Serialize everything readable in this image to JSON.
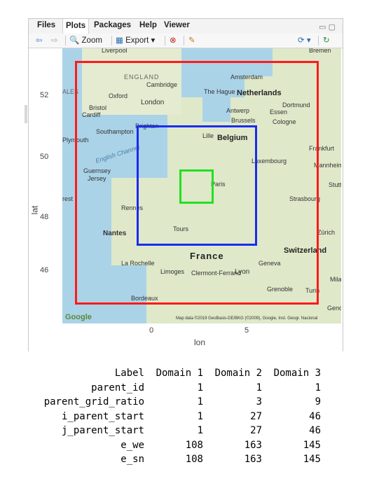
{
  "tabs": [
    "Files",
    "Plots",
    "Packages",
    "Help",
    "Viewer"
  ],
  "active_tab": "Plots",
  "toolbar": {
    "zoom_label": "Zoom",
    "export_label": "Export ▾",
    "back_icon": "arrow-left-icon",
    "forward_icon": "arrow-right-icon",
    "zoom_icon": "magnifier-icon",
    "export_icon": "image-icon",
    "remove_icon": "remove-plot-icon",
    "clear_icon": "broom-icon",
    "publish_icon": "publish-icon",
    "refresh_icon": "refresh-icon"
  },
  "plot": {
    "x_title": "lon",
    "y_title": "lat",
    "x_ticks": [
      "0",
      "5"
    ],
    "y_ticks": [
      "46",
      "48",
      "50",
      "52"
    ],
    "attribution": "Map data ©2019 GeoBasis-DE/BKG (©2009), Google, Inst. Geogr. Nacional",
    "google_logo": "Google"
  },
  "map_labels": {
    "liverpool": "Liverpool",
    "bremen": "Bremen",
    "england": "ENGLAND",
    "cambridge": "Cambridge",
    "amsterdam": "Amsterdam",
    "wales": "ALES",
    "oxford": "Oxford",
    "london": "London",
    "hague": "The Hague",
    "netherlands": "Netherlands",
    "bristol": "Bristol",
    "cardiff": "Cardiff",
    "antwerp": "Antwerp",
    "dortmund": "Dortmund",
    "essen": "Essen",
    "brussels": "Brussels",
    "cologne": "Cologne",
    "brighton": "Brighton",
    "southampton": "Southampton",
    "lille": "Lille",
    "belgium": "Belgium",
    "plymouth": "Plymouth",
    "channel": "English Channel",
    "frankfurt": "Frankfurt",
    "luxembourg": "Luxembourg",
    "mannheim": "Mannheim",
    "guernsey": "Guernsey",
    "jersey": "Jersey",
    "paris": "Paris",
    "stuttgart": "Stuttg",
    "brest": "rest",
    "rennes": "Rennes",
    "strasbourg": "Strasbourg",
    "nantes": "Nantes",
    "tours": "Tours",
    "zurich": "Zürich",
    "france": "France",
    "switzerland": "Switzerland",
    "larochelle": "La Rochelle",
    "geneva": "Geneva",
    "limoges": "Limoges",
    "clermont": "Clermont-Ferrand",
    "lyon": "Lyon",
    "milan": "Mila",
    "grenoble": "Grenoble",
    "turin": "Turin",
    "bordeaux": "Bordeaux",
    "genoa": "Genoa"
  },
  "domain_colors": [
    "#ff1a1a",
    "#1a2cf0",
    "#22e022"
  ],
  "table": {
    "header": [
      "Label",
      "Domain 1",
      "Domain 2",
      "Domain 3"
    ],
    "rows": [
      [
        "parent_id",
        "1",
        "1",
        "1"
      ],
      [
        "parent_grid_ratio",
        "1",
        "3",
        "9"
      ],
      [
        "i_parent_start",
        "1",
        "27",
        "46"
      ],
      [
        "j_parent_start",
        "1",
        "27",
        "46"
      ],
      [
        "e_we",
        "108",
        "163",
        "145"
      ],
      [
        "e_sn",
        "108",
        "163",
        "145"
      ]
    ]
  }
}
